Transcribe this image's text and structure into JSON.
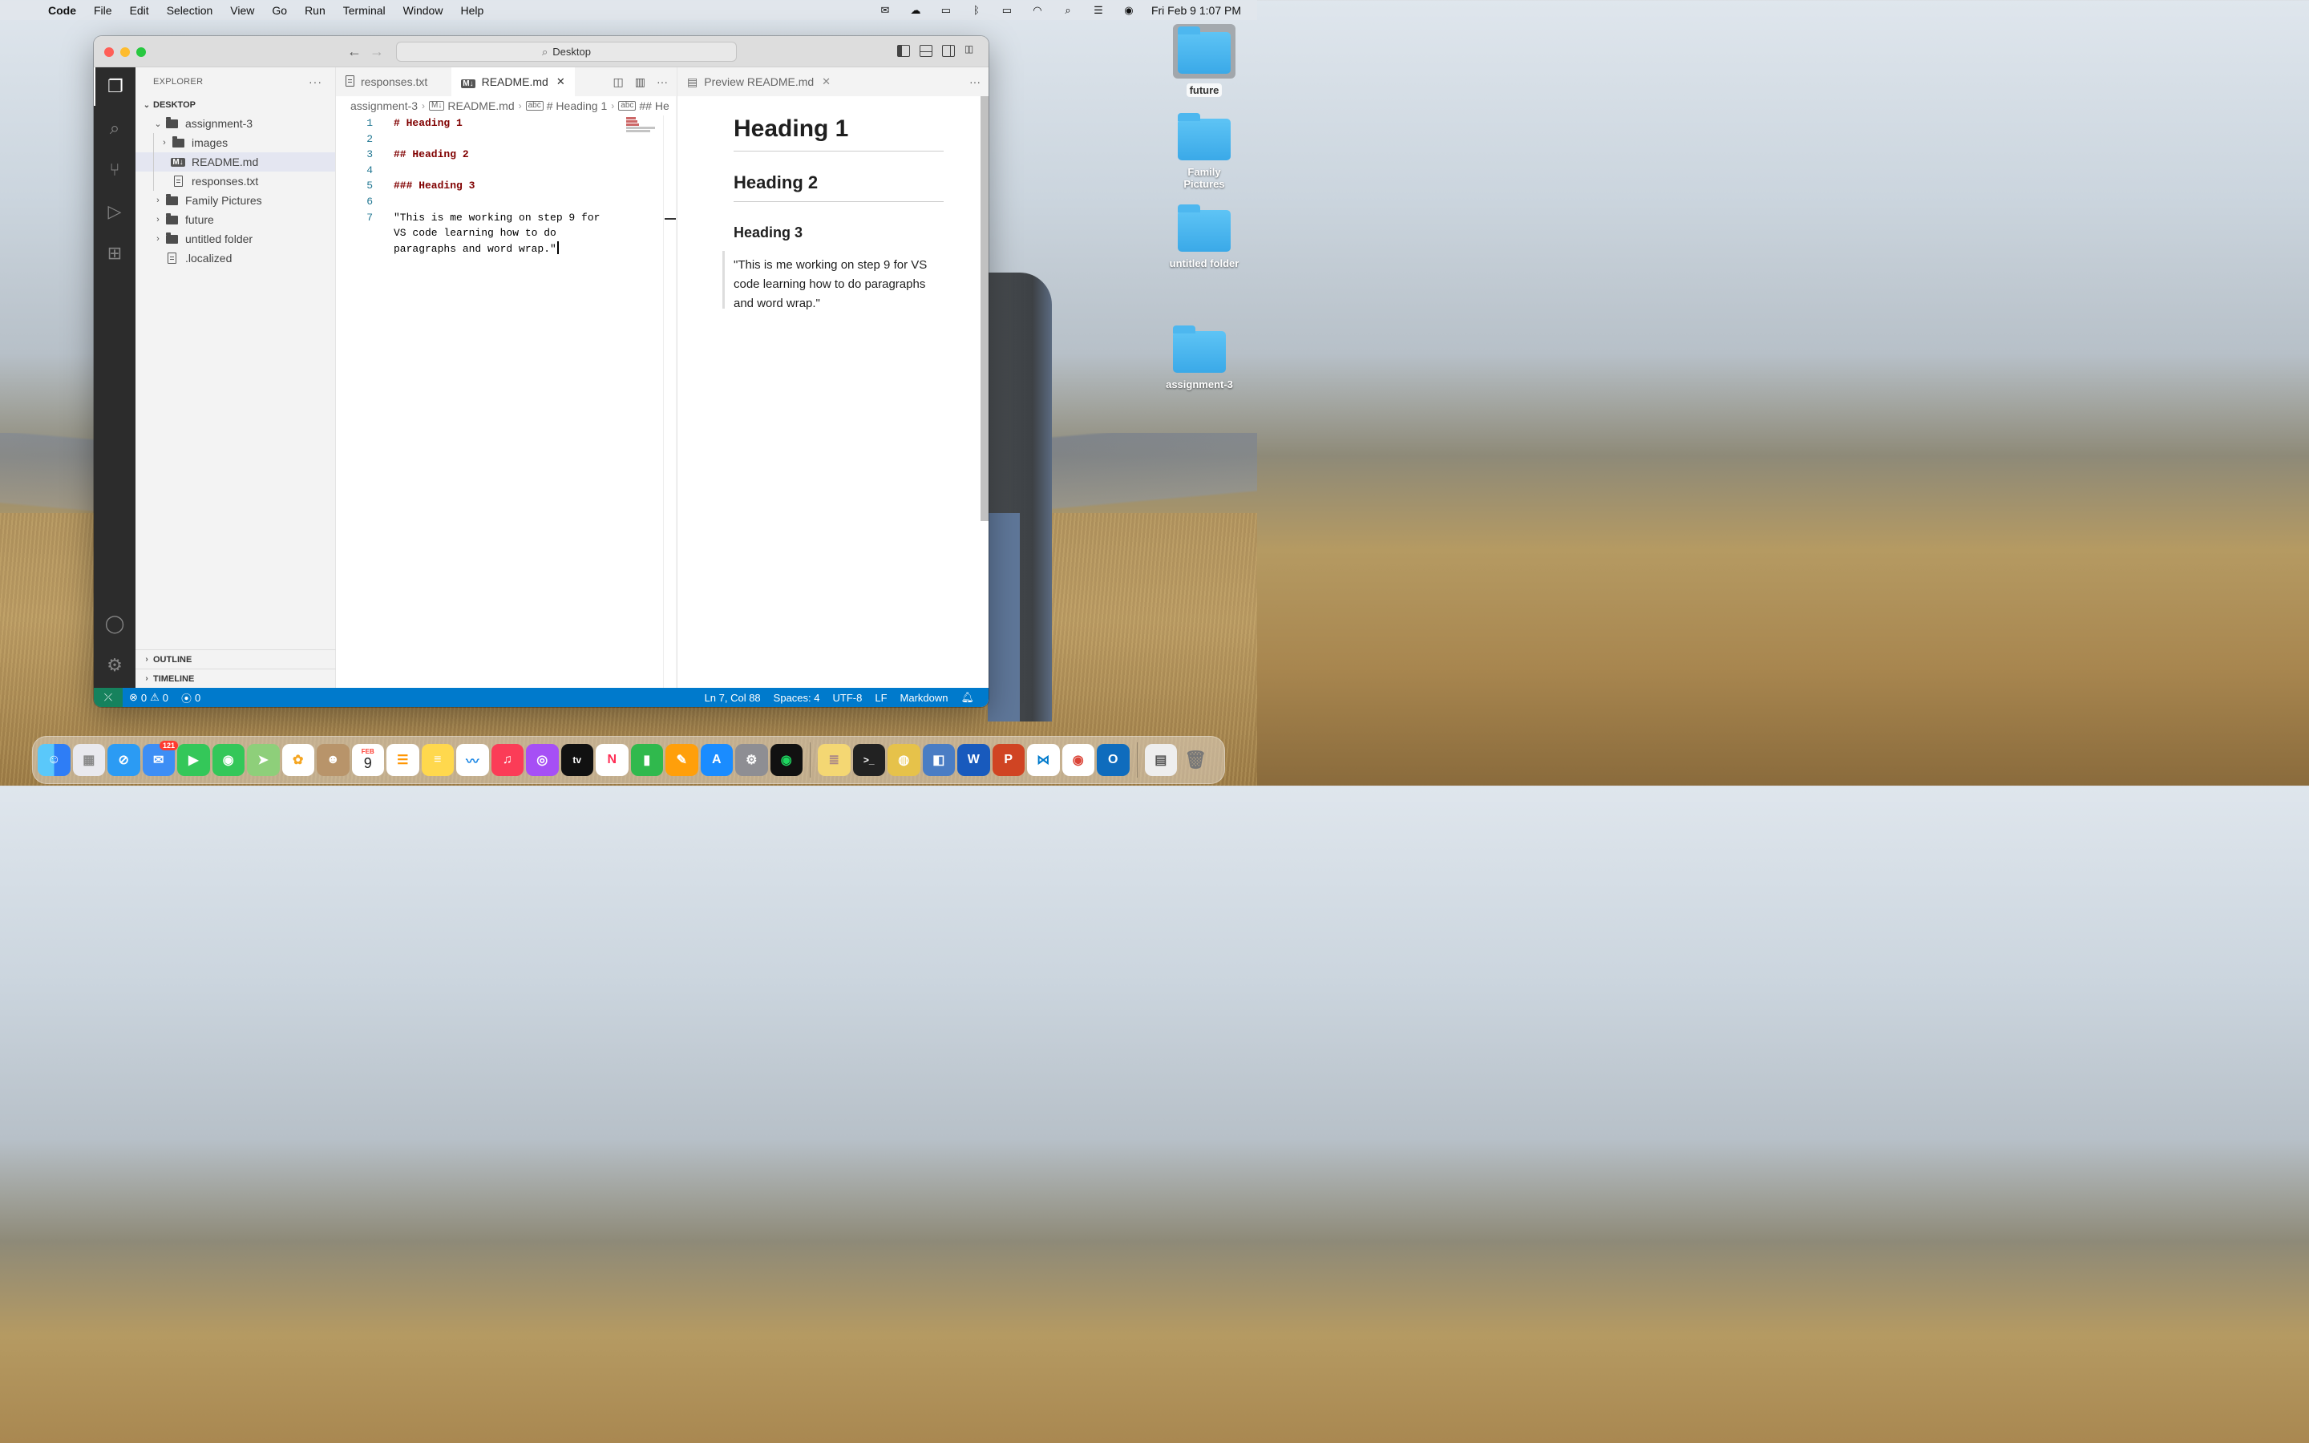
{
  "menubar": {
    "apple": "",
    "app_name": "Code",
    "menus": [
      "File",
      "Edit",
      "Selection",
      "View",
      "Go",
      "Run",
      "Terminal",
      "Window",
      "Help"
    ],
    "datetime": "Fri Feb 9  1:07 PM"
  },
  "desktop_icons": [
    {
      "label": "future"
    },
    {
      "label": "Family Pictures"
    },
    {
      "label": "untitled folder"
    },
    {
      "label": "assignment-3"
    }
  ],
  "titlebar": {
    "search_text": "Desktop"
  },
  "sidebar": {
    "title": "EXPLORER",
    "more": "···",
    "root": "DESKTOP",
    "tree": [
      {
        "label": "assignment-3",
        "type": "folder",
        "expanded": true,
        "depth": 1
      },
      {
        "label": "images",
        "type": "folder",
        "expanded": false,
        "depth": 2
      },
      {
        "label": "README.md",
        "type": "markdown",
        "depth": 2,
        "selected": true
      },
      {
        "label": "responses.txt",
        "type": "file",
        "depth": 2
      },
      {
        "label": "Family Pictures",
        "type": "folder",
        "expanded": false,
        "depth": 1
      },
      {
        "label": "future",
        "type": "folder",
        "expanded": false,
        "depth": 1
      },
      {
        "label": "untitled folder",
        "type": "folder",
        "expanded": false,
        "depth": 1
      },
      {
        "label": ".localized",
        "type": "file",
        "depth": 1
      }
    ],
    "outline": "OUTLINE",
    "timeline": "TIMELINE"
  },
  "editor": {
    "tabs": [
      {
        "label": "responses.txt",
        "active": false
      },
      {
        "label": "README.md",
        "active": true
      }
    ],
    "breadcrumb": [
      "assignment-3",
      "README.md",
      "# Heading 1",
      "## He"
    ],
    "lines": [
      {
        "n": "1",
        "text": "# Heading 1",
        "heading": true
      },
      {
        "n": "2",
        "text": "",
        "heading": false
      },
      {
        "n": "3",
        "text": "## Heading 2",
        "heading": true
      },
      {
        "n": "4",
        "text": "",
        "heading": false
      },
      {
        "n": "5",
        "text": "### Heading 3",
        "heading": true
      },
      {
        "n": "6",
        "text": "",
        "heading": false
      },
      {
        "n": "7",
        "text": "\"This is me working on step 9 for",
        "heading": false
      },
      {
        "n": "",
        "text": "VS code learning how to do",
        "heading": false
      },
      {
        "n": "",
        "text": "paragraphs and word wrap.\"",
        "heading": false,
        "cursor": true
      }
    ]
  },
  "preview": {
    "tab_label": "Preview README.md",
    "h1": "Heading 1",
    "h2": "Heading 2",
    "h3": "Heading 3",
    "quote": "\"This is me working on step 9 for VS code learning how to do paragraphs and word wrap.\""
  },
  "statusbar": {
    "errors": "0",
    "warnings": "0",
    "ports": "0",
    "position": "Ln 7, Col 88",
    "spaces": "Spaces: 4",
    "encoding": "UTF-8",
    "eol": "LF",
    "language": "Markdown"
  },
  "dock": {
    "mail_badge": "121",
    "calendar_month": "FEB",
    "calendar_day": "9",
    "apps": [
      "finder",
      "launchpad",
      "safari",
      "mail",
      "facetime",
      "messages",
      "maps",
      "photos",
      "contacts",
      "calendar",
      "reminders",
      "notes",
      "freeform",
      "music",
      "podcasts",
      "tv",
      "news",
      "numbers",
      "pages",
      "app-store",
      "system-settings",
      "spotify",
      "stickies",
      "terminal",
      "chrome-canary",
      "preview",
      "word",
      "powerpoint",
      "vscode",
      "chrome",
      "outlook",
      "documents",
      "trash"
    ]
  },
  "colors": {
    "statusbar": "#007acc",
    "activitybar": "#2c2c2c",
    "heading_syntax": "#800000",
    "line_number": "#237893",
    "folder_blue": "#3aa9e8"
  }
}
